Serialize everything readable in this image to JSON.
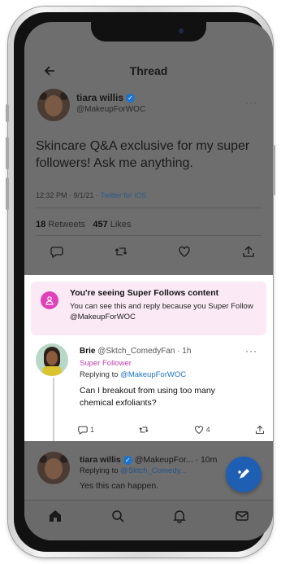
{
  "header": {
    "title": "Thread"
  },
  "tweet": {
    "author_name": "tiara willis",
    "author_handle": "@MakeupForWOC",
    "text": "Skincare Q&A exclusive for my super followers! Ask me anything.",
    "time": "12:32 PM · 9/1/21 ·",
    "source": "Twitter for iOS",
    "retweets_count": "18",
    "retweets_label": "Retweets",
    "likes_count": "457",
    "likes_label": "Likes"
  },
  "super_follows_banner": {
    "title": "You're seeing Super Follows content",
    "description": "You can see this and reply because you Super Follow @MakeupForWOC"
  },
  "reply": {
    "author_name": "Brie",
    "author_handle": "@Sktch_ComedyFan · 1h",
    "badge": "Super Follower",
    "replying_prefix": "Replying to",
    "replying_to": "@MakeupForWOC",
    "text": "Can I breakout from using too many chemical exfoliants?",
    "reply_count": "1",
    "like_count": "4"
  },
  "reply2": {
    "author_name": "tiara willis",
    "author_handle": "@MakeupFor... · 10m",
    "replying_prefix": "Replying to",
    "replying_to": "@Sktch_Comedy...",
    "text": "Yes this can happen."
  },
  "colors": {
    "accent": "#1d73c9",
    "super_follow_pink": "#e040b8",
    "banner_bg": "#fbeaf6"
  },
  "icons": {
    "back": "arrow-left-icon",
    "verified": "verified-badge-icon",
    "fab": "compose-icon",
    "nav": [
      "home-icon",
      "search-icon",
      "notifications-icon",
      "messages-icon"
    ]
  }
}
